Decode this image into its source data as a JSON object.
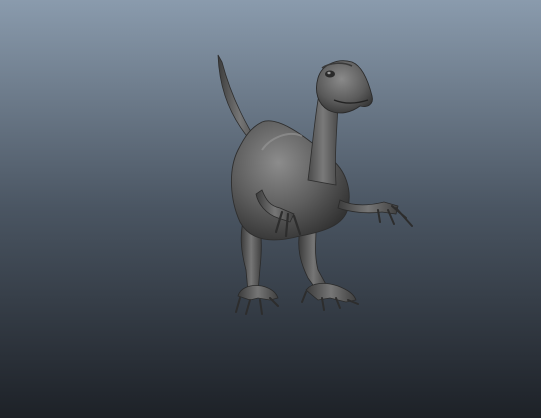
{
  "viewport": {
    "background_top": "#8a9bad",
    "background_mid": "#4a5562",
    "background_bottom": "#1d2127"
  },
  "model": {
    "name": "raptor",
    "shading": "grey",
    "base_color": "#5c5c5c",
    "highlight_color": "#8a8a8a",
    "shadow_color": "#2f2f2f"
  }
}
